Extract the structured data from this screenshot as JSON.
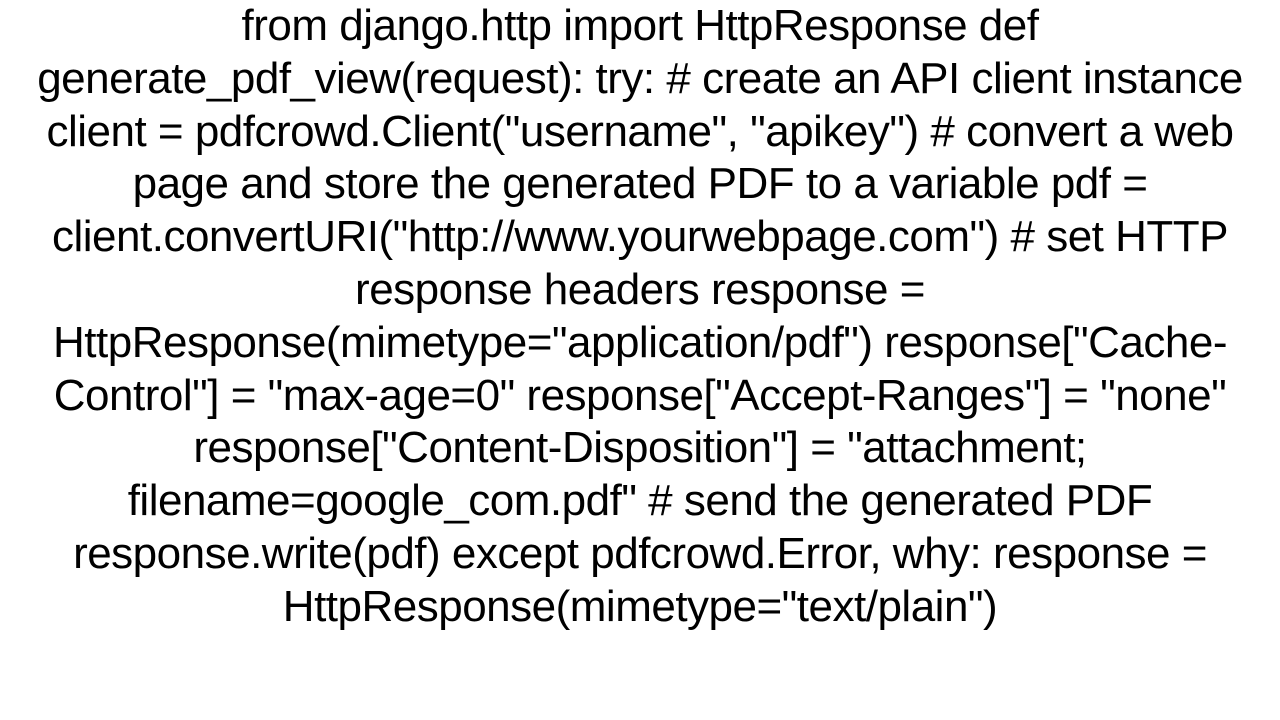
{
  "code": {
    "content": "from django.http import HttpResponse  def generate_pdf_view(request):     try:         # create an API client instance         client = pdfcrowd.Client(\"username\", \"apikey\")          # convert a web page and store the generated PDF to a variable         pdf = client.convertURI(\"http://www.yourwebpage.com\")           # set HTTP response headers         response = HttpResponse(mimetype=\"application/pdf\")         response[\"Cache-Control\"] = \"max-age=0\"         response[\"Accept-Ranges\"] = \"none\"         response[\"Content-Disposition\"] = \"attachment; filename=google_com.pdf\"          # send the generated PDF         response.write(pdf)     except pdfcrowd.Error, why:         response = HttpResponse(mimetype=\"text/plain\")"
  }
}
